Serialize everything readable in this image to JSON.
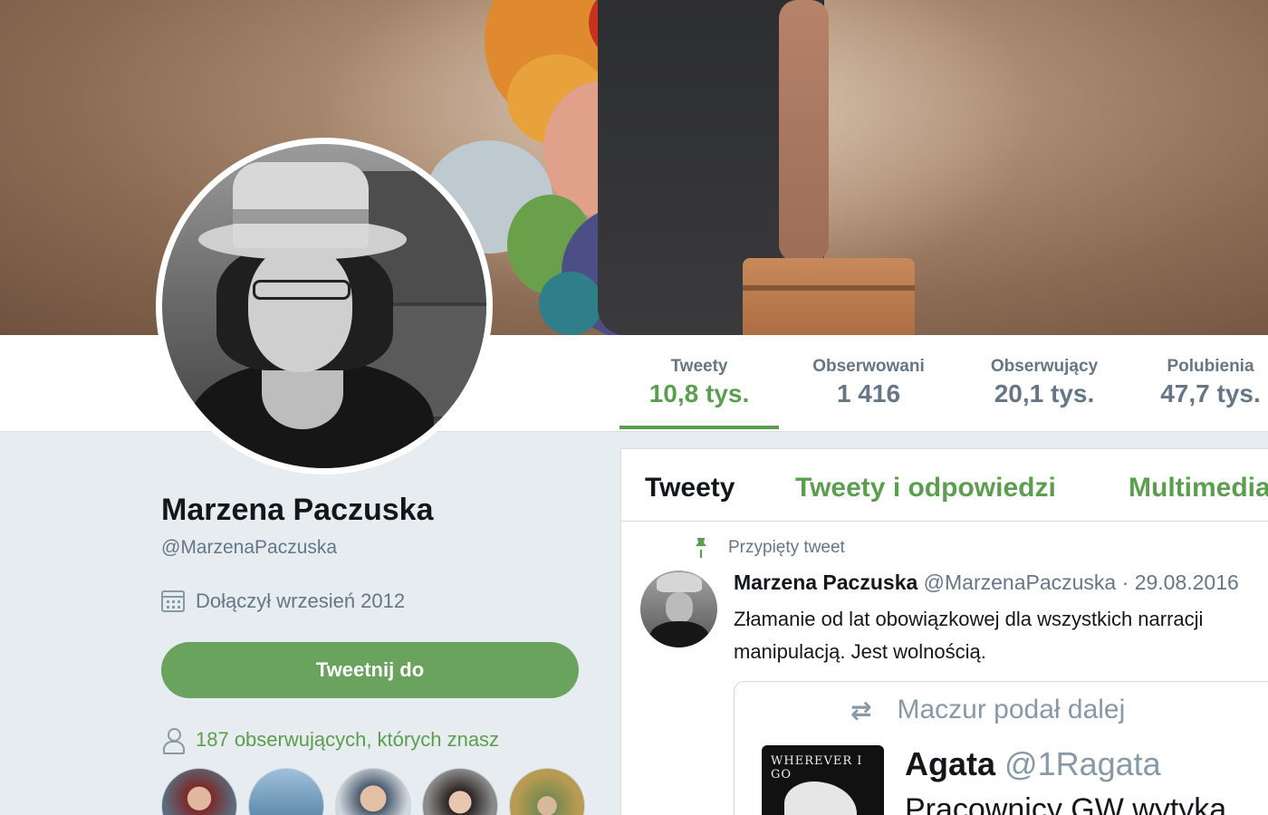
{
  "stats": [
    {
      "label": "Tweety",
      "value": "10,8 tys."
    },
    {
      "label": "Obserwowani",
      "value": "1 416"
    },
    {
      "label": "Obserwujący",
      "value": "20,1 tys."
    },
    {
      "label": "Polubienia",
      "value": "47,7 tys."
    }
  ],
  "profile": {
    "name": "Marzena Paczuska",
    "handle": "@MarzenaPaczuska",
    "joined": "Dołączył wrzesień 2012",
    "tweet_to_label": "Tweetnij do",
    "followers_known": "187 obserwujących, których znasz"
  },
  "tabs": [
    "Tweety",
    "Tweety i odpowiedzi",
    "Multimedia"
  ],
  "pinned_tweet": {
    "pinned_label": "Przypięty tweet",
    "author_name": "Marzena Paczuska",
    "author_handle": "@MarzenaPaczuska",
    "separator": "·",
    "date": "29.08.2016",
    "text_line1": "Złamanie od lat obowiązkowej dla wszystkich narracji",
    "text_line2": "manipulacją. Jest wolnością.",
    "quote": {
      "retweet_label": "Maczur podał dalej",
      "media_caption": "WHEREVER I GO",
      "author_name": "Agata",
      "author_handle": "@1Ragata",
      "text": "Pracownicy GW wytyka"
    }
  },
  "colors": {
    "accent": "#5c9e4f",
    "button": "#6aa35e",
    "muted": "#657786",
    "page_bg": "#e6ecf0"
  },
  "icons": {
    "joined": "calendar-icon",
    "followers": "person-icon",
    "pinned": "pin-icon",
    "retweet": "retweet-icon"
  }
}
